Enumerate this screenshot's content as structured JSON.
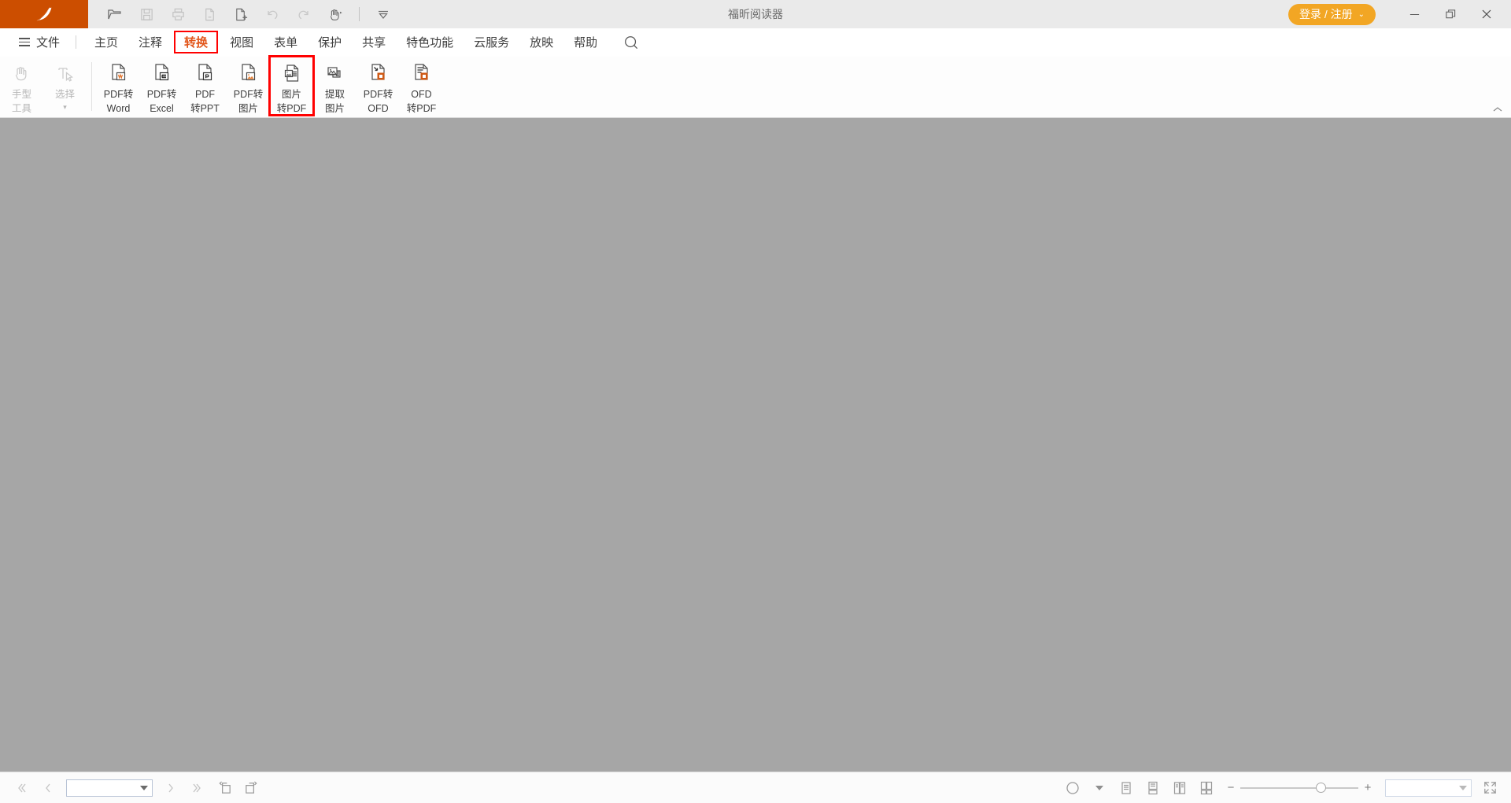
{
  "window": {
    "title": "福昕阅读器",
    "logo_icon": "foxit-logo-icon",
    "login_label": "登录 / 注册",
    "login_caret": "⌄",
    "minimize_icon": "minimize-icon",
    "restore_icon": "restore-icon",
    "close_icon": "close-icon",
    "brand_color": "#cc4e00",
    "login_color": "#f2a624"
  },
  "quick_access": {
    "items": [
      {
        "name": "open-file-icon",
        "tip": "打开"
      },
      {
        "name": "save-icon",
        "tip": "保存"
      },
      {
        "name": "print-icon",
        "tip": "打印"
      },
      {
        "name": "email-attachment-icon",
        "tip": "以附件形式发送"
      },
      {
        "name": "create-pdf-icon",
        "tip": "从文件创建PDF"
      },
      {
        "name": "undo-icon",
        "tip": "撤销"
      },
      {
        "name": "redo-icon",
        "tip": "重做"
      },
      {
        "name": "hand-tool-icon",
        "tip": "手型工具"
      }
    ],
    "customize_icon": "customize-toolbar-icon"
  },
  "menubar": {
    "file_label": "文件",
    "hamburger_icon": "hamburger-icon",
    "search_icon": "search-icon",
    "items": [
      {
        "label": "主页",
        "active": false
      },
      {
        "label": "注释",
        "active": false
      },
      {
        "label": "转换",
        "active": true
      },
      {
        "label": "视图",
        "active": false
      },
      {
        "label": "表单",
        "active": false
      },
      {
        "label": "保护",
        "active": false
      },
      {
        "label": "共享",
        "active": false
      },
      {
        "label": "特色功能",
        "active": false
      },
      {
        "label": "云服务",
        "active": false
      },
      {
        "label": "放映",
        "active": false
      },
      {
        "label": "帮助",
        "active": false
      }
    ],
    "highlight_color": "#ff0000",
    "active_text_color": "#e2561b"
  },
  "ribbon": {
    "tools": [
      {
        "icon": "hand-tool-icon",
        "line1": "手型",
        "line2": "工具",
        "disabled": true,
        "highlight": false
      },
      {
        "icon": "select-text-icon",
        "line1": "选择",
        "line2": "▾",
        "disabled": true,
        "highlight": false
      }
    ],
    "converters": [
      {
        "icon": "pdf-to-word-icon",
        "line1": "PDF转",
        "line2": "Word",
        "highlight": false
      },
      {
        "icon": "pdf-to-excel-icon",
        "line1": "PDF转",
        "line2": "Excel",
        "highlight": false
      },
      {
        "icon": "pdf-to-ppt-icon",
        "line1": "PDF",
        "line2": "转PPT",
        "highlight": false
      },
      {
        "icon": "pdf-to-image-icon",
        "line1": "PDF转",
        "line2": "图片",
        "highlight": false
      },
      {
        "icon": "image-to-pdf-icon",
        "line1": "图片",
        "line2": "转PDF",
        "highlight": true
      },
      {
        "icon": "extract-image-icon",
        "line1": "提取",
        "line2": "图片",
        "highlight": false
      },
      {
        "icon": "pdf-to-ofd-icon",
        "line1": "PDF转",
        "line2": "OFD",
        "highlight": false
      },
      {
        "icon": "ofd-to-pdf-icon",
        "line1": "OFD",
        "line2": "转PDF",
        "highlight": false
      }
    ],
    "collapse_icon": "chevron-up-icon"
  },
  "statusbar": {
    "first_page_icon": "first-page-icon",
    "prev_page_icon": "prev-page-icon",
    "page_value": "",
    "next_page_icon": "next-page-icon",
    "last_page_icon": "last-page-icon",
    "rotate_left_icon": "rotate-left-icon",
    "rotate_right_icon": "rotate-right-icon",
    "read_mode_icon": "read-mode-icon",
    "read_mode_caret": "▾",
    "single_page_icon": "single-page-view-icon",
    "continuous_icon": "continuous-view-icon",
    "facing_icon": "facing-view-icon",
    "facing_continuous_icon": "facing-continuous-view-icon",
    "zoom_out_label": "−",
    "zoom_in_label": "+",
    "zoom_value": "",
    "zoom_percent": 64,
    "fullscreen_icon": "fullscreen-icon"
  },
  "canvas": {
    "background_color": "#a6a6a6"
  }
}
